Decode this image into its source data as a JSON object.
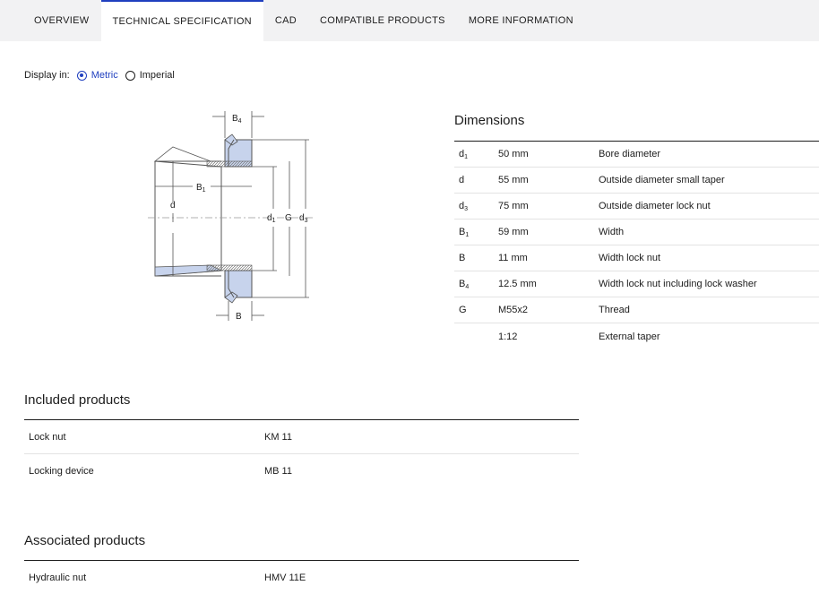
{
  "tabs": [
    {
      "label": "OVERVIEW"
    },
    {
      "label": "TECHNICAL SPECIFICATION"
    },
    {
      "label": "CAD"
    },
    {
      "label": "COMPATIBLE PRODUCTS"
    },
    {
      "label": "MORE INFORMATION"
    }
  ],
  "display": {
    "label": "Display in:",
    "options": [
      {
        "label": "Metric",
        "selected": true
      },
      {
        "label": "Imperial",
        "selected": false
      }
    ]
  },
  "drawing": {
    "labels": {
      "b4": "B",
      "b4_sub": "4",
      "b1": "B",
      "b1_sub": "1",
      "d": "d",
      "d1": "d",
      "d1_sub": "1",
      "g": "G",
      "d3": "d",
      "d3_sub": "3",
      "b": "B"
    },
    "colors": {
      "fill": "#c7d3ec",
      "line": "#555555",
      "hatch": "#777777"
    }
  },
  "dimensions": {
    "title": "Dimensions",
    "rows": [
      {
        "sym": "d",
        "sub": "1",
        "value": "50 mm",
        "desc": "Bore diameter"
      },
      {
        "sym": "d",
        "sub": "",
        "value": "55 mm",
        "desc": "Outside diameter small taper"
      },
      {
        "sym": "d",
        "sub": "3",
        "value": "75 mm",
        "desc": "Outside diameter lock nut"
      },
      {
        "sym": "B",
        "sub": "1",
        "value": "59 mm",
        "desc": "Width"
      },
      {
        "sym": "B",
        "sub": "",
        "value": "11 mm",
        "desc": "Width lock nut"
      },
      {
        "sym": "B",
        "sub": "4",
        "value": "12.5 mm",
        "desc": "Width lock nut including lock washer"
      },
      {
        "sym": "G",
        "sub": "",
        "value": "M55x2",
        "desc": "Thread"
      },
      {
        "sym": "",
        "sub": "",
        "value": "1:12",
        "desc": "External taper"
      }
    ]
  },
  "included": {
    "title": "Included products",
    "rows": [
      {
        "name": "Lock nut",
        "value": "KM 11"
      },
      {
        "name": "Locking device",
        "value": "MB 11"
      }
    ]
  },
  "associated": {
    "title": "Associated products",
    "rows": [
      {
        "name": "Hydraulic nut",
        "value": "HMV 11E"
      }
    ]
  },
  "colors": {
    "accent": "#1f3fbf",
    "tabbar_bg": "#f2f2f3"
  }
}
